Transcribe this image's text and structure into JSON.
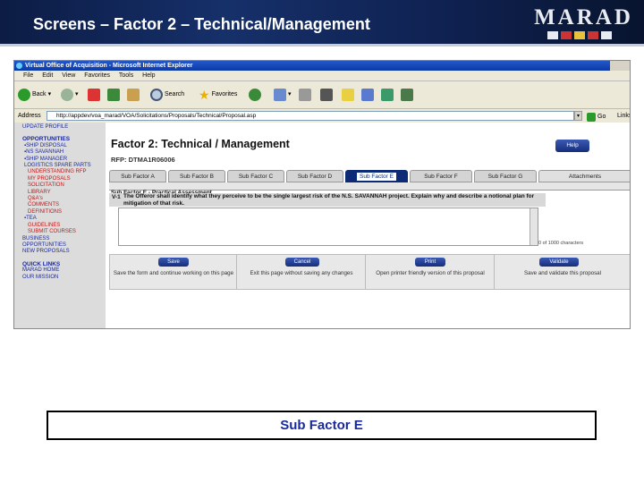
{
  "slide": {
    "title": "Screens – Factor 2 – Technical/Management",
    "logo_text": "MARAD",
    "caption": "Sub Factor E"
  },
  "browser": {
    "window_title": "Virtual Office of Acquisition - Microsoft Internet Explorer",
    "menu": [
      "File",
      "Edit",
      "View",
      "Favorites",
      "Tools",
      "Help"
    ],
    "toolbar": {
      "back": "Back",
      "search": "Search",
      "favorites": "Favorites"
    },
    "address_label": "Address",
    "address_value": "http://appdev/voa_marad/VOA/Solicitations/Proposals/Technical/Proposal.asp",
    "go_label": "Go",
    "links_label": "Links"
  },
  "sidebar": {
    "top": [
      "UPDATE PROFILE"
    ],
    "opportunities_head": "OPPORTUNITIES",
    "opportunities": [
      "SHIP DISPOSAL",
      "NS SAVANNAH",
      "SHIP MANAGER",
      "LOGISTICS SPARE PARTS"
    ],
    "savannah_items": [
      "UNDERSTANDING RFP",
      "MY PROPOSALS",
      "SOLICITATION",
      "LIBRARY",
      "Q&A's",
      "COMMENTS",
      "DEFINITIONS"
    ],
    "tea_head": "TEA",
    "tea_items": [
      "GUIDELINES",
      "SUBMIT COURSES"
    ],
    "other": [
      "BUSINESS",
      "OPPORTUNITIES",
      "NEW PROPOSALS"
    ],
    "quick_links_head": "QUICK LINKS",
    "quick_links": [
      "MARAD HOME",
      "OUR MISSION"
    ]
  },
  "main": {
    "title": "Factor 2: Technical / Management",
    "help_label": "Help",
    "rfp_label": "RFP: DTMA1R06006",
    "tabs": [
      "Sub Factor A",
      "Sub Factor B",
      "Sub Factor C",
      "Sub Factor D",
      "Sub Factor E",
      "Sub Factor F",
      "Sub Factor G",
      "Attachments"
    ],
    "active_tab": "Sub Factor E",
    "panel_title": "Sub Factor E - Practical Assessment",
    "question_number": "V-1",
    "question_text": "The Offeror shall identify what they perceive to be the single largest risk of the N.S. SAVANNAH project. Explain why and describe a notional plan for mitigation of that risk.",
    "answer_value": "",
    "chars_label": "0 of 1000 characters",
    "actions": [
      {
        "button": "Save",
        "desc": "Save the form and continue working on this page"
      },
      {
        "button": "Cancel",
        "desc": "Exit this page without saving any changes"
      },
      {
        "button": "Print",
        "desc": "Open printer friendly version of this proposal"
      },
      {
        "button": "Validate",
        "desc": "Save and validate this proposal"
      }
    ]
  },
  "colors": {
    "header_navy": "#0f2150",
    "active_tab": "#0d2a77",
    "link_blue": "#1a2a9c",
    "link_red": "#c01818"
  }
}
